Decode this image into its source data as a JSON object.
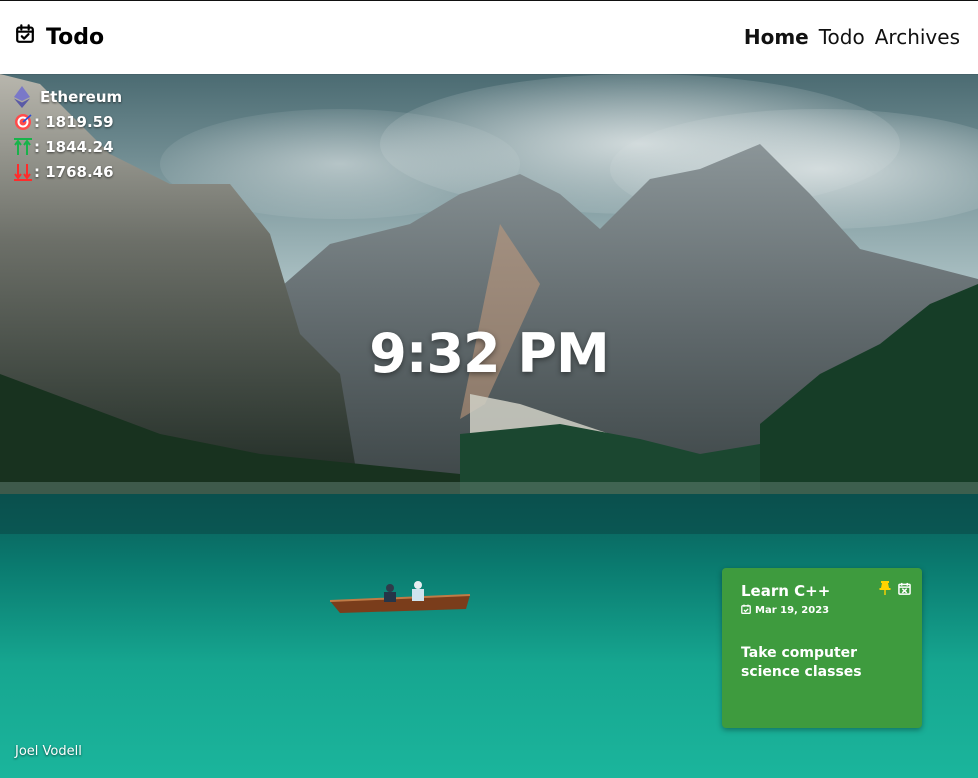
{
  "app": {
    "title": "Todo",
    "nav": [
      {
        "label": "Home"
      },
      {
        "label": "Todo"
      },
      {
        "label": "Archives"
      }
    ]
  },
  "crypto": {
    "coin": "Ethereum",
    "current": ": 1819.59",
    "high": ": 1844.24",
    "low": ": 1768.46"
  },
  "clock": {
    "time": "9:32 PM"
  },
  "photo_credit": "Joel Vodell",
  "note": {
    "title": "Learn C++",
    "date": "Mar 19, 2023",
    "body": "Take computer science classes",
    "color": "#3e9b3e"
  },
  "colors": {
    "accent_green": "#3e9b3e",
    "up": "#18b34a",
    "down": "#ff2b2b",
    "pin": "#ffd400"
  }
}
